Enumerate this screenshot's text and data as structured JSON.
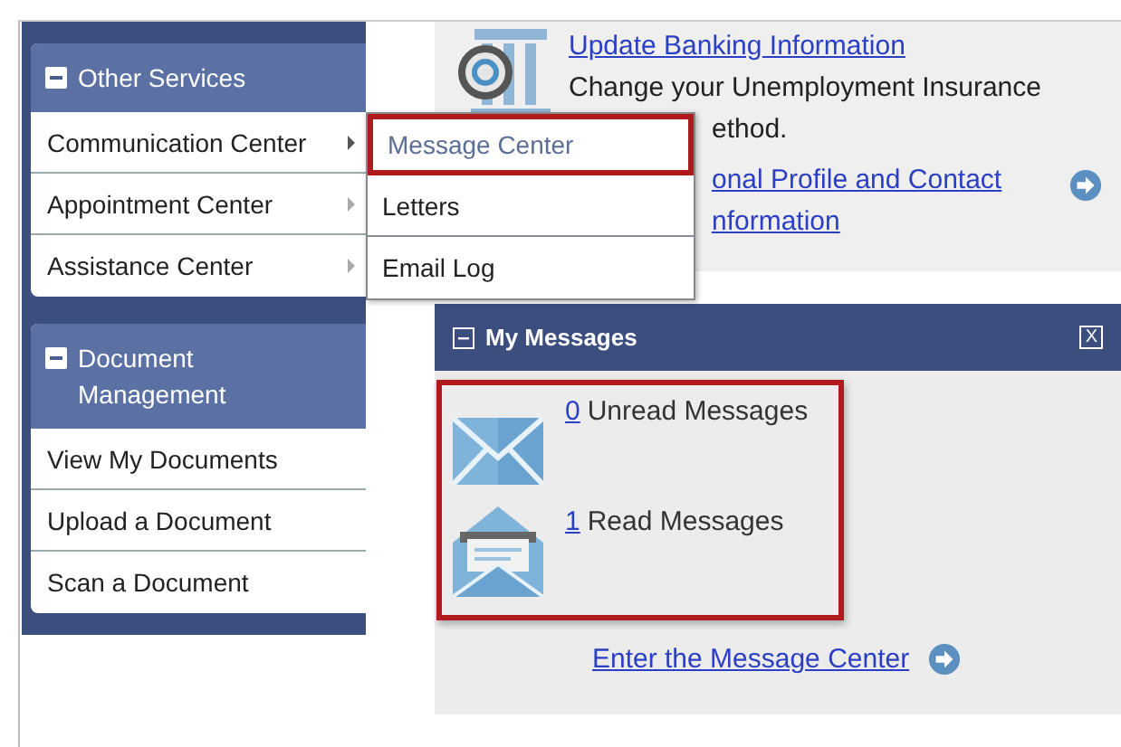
{
  "sidebar": {
    "panels": [
      {
        "title": "Other Services",
        "expanded": true,
        "items": [
          {
            "label": "Communication Center",
            "has_submenu": true
          },
          {
            "label": "Appointment Center",
            "has_submenu": true
          },
          {
            "label": "Assistance Center",
            "has_submenu": true
          }
        ]
      },
      {
        "title": "Document Management",
        "expanded": true,
        "items": [
          {
            "label": "View My Documents",
            "has_submenu": false
          },
          {
            "label": "Upload a Document",
            "has_submenu": false
          },
          {
            "label": "Scan a Document",
            "has_submenu": false
          }
        ]
      }
    ]
  },
  "submenu": {
    "items": [
      {
        "label": "Message Center",
        "highlighted": true
      },
      {
        "label": "Letters",
        "highlighted": false
      },
      {
        "label": "Email Log",
        "highlighted": false
      }
    ]
  },
  "banking_card": {
    "link": "Update Banking Information",
    "lines": [
      "Change your Unemployment Insurance",
      "ethod."
    ],
    "profile_link_lines": [
      "onal Profile and Contact",
      "nformation"
    ]
  },
  "messages_panel": {
    "title": "My Messages",
    "expanded": true,
    "close": "X",
    "entries": [
      {
        "kind": "unread",
        "count": "0",
        "label": "Unread Messages"
      },
      {
        "kind": "read",
        "count": "1",
        "label": "Read Messages"
      }
    ],
    "link": "Enter the Message Center"
  }
}
